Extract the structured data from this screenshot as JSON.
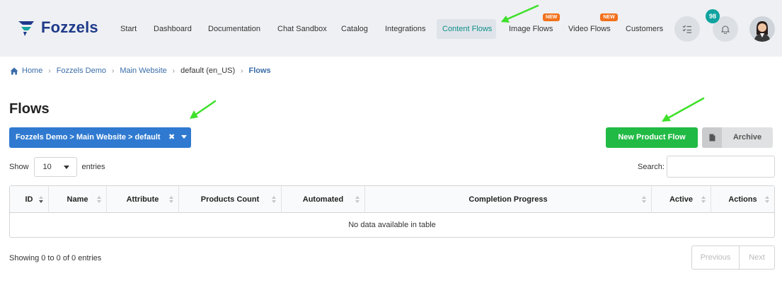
{
  "app": {
    "brand": "Fozzels",
    "brand_color": "#1f3a8a",
    "accent_color": "#0e8f86"
  },
  "nav": {
    "items": [
      {
        "label": "Start"
      },
      {
        "label": "Dashboard"
      },
      {
        "label": "Documentation"
      },
      {
        "label": "Chat Sandbox"
      },
      {
        "label": "Catalog"
      },
      {
        "label": "Integrations"
      },
      {
        "label": "Content Flows",
        "active": true
      },
      {
        "label": "Image Flows",
        "badge": "NEW"
      },
      {
        "label": "Video Flows",
        "badge": "NEW"
      },
      {
        "label": "Customers"
      }
    ],
    "tasks_icon": "list-check-icon",
    "notifications_icon": "bell-icon",
    "notifications_count": "98"
  },
  "breadcrumb": {
    "home": "Home",
    "items": [
      "Fozzels Demo",
      "Main Website",
      "default (en_US)"
    ],
    "current": "Flows"
  },
  "page": {
    "title": "Flows",
    "scope_filter": "Fozzels Demo > Main Website > default",
    "clear_icon": "✖",
    "new_button": "New Product Flow",
    "archive_button": "Archive",
    "archive_icon": "document-icon"
  },
  "table_controls": {
    "show_label": "Show",
    "page_length": "10",
    "entries_label": "entries",
    "search_label": "Search:",
    "search_value": ""
  },
  "table": {
    "columns": [
      "ID",
      "Name",
      "Attribute",
      "Products Count",
      "Automated",
      "Completion Progress",
      "Active",
      "Actions"
    ],
    "empty_message": "No data available in table"
  },
  "footer": {
    "info": "Showing 0 to 0 of 0 entries",
    "previous": "Previous",
    "next": "Next"
  },
  "colors": {
    "primary": "#2f7ad0",
    "success": "#21ba45",
    "badge_new": "#f2711c",
    "annotation_arrow": "#3ee02a"
  }
}
